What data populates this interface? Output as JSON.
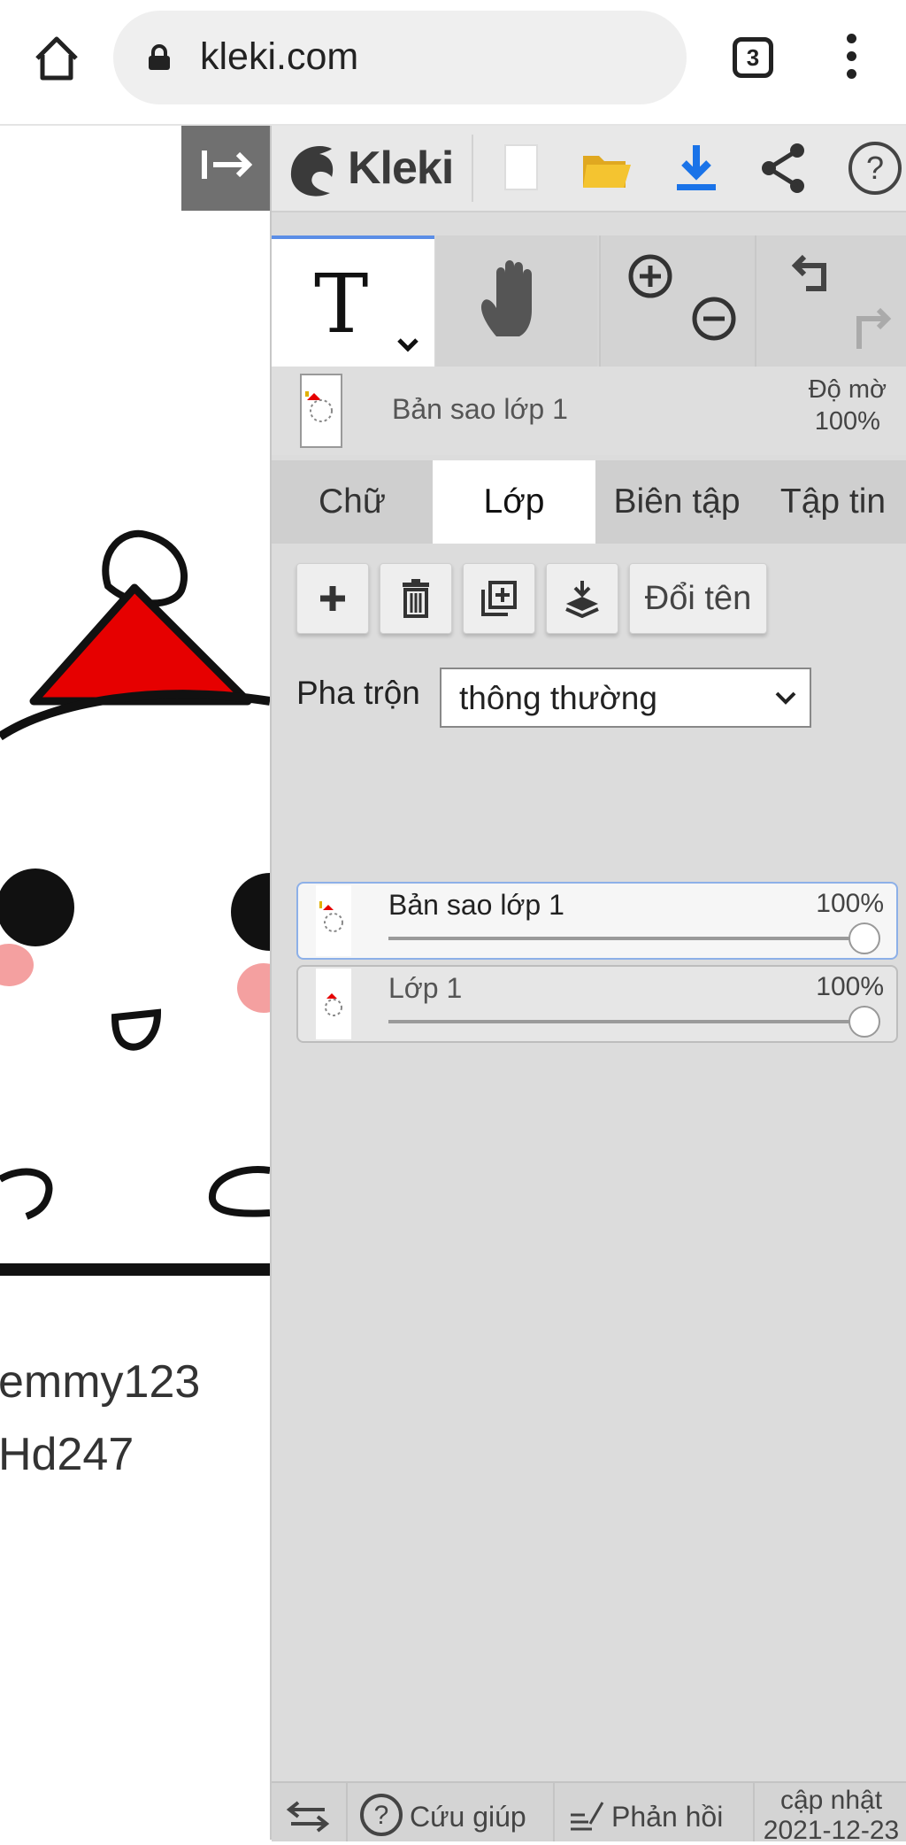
{
  "browser": {
    "url": "kleki.com",
    "tab_count": "3"
  },
  "canvas": {
    "text_lines": "emmy123\nHd247"
  },
  "toolbar": {
    "logo_text": "Kleki"
  },
  "layer_header": {
    "name": "Bản sao lớp 1",
    "opacity_label": "Độ mờ",
    "opacity_value": "100%"
  },
  "tabs": [
    {
      "label": "Chữ"
    },
    {
      "label": "Lớp"
    },
    {
      "label": "Biên tập"
    },
    {
      "label": "Tập tin"
    }
  ],
  "layer_actions": {
    "rename_label": "Đổi tên"
  },
  "blend": {
    "label": "Pha trộn",
    "value": "thông thường"
  },
  "layers": [
    {
      "name": "Bản sao lớp 1",
      "opacity": "100%",
      "opacity_value": 1.0
    },
    {
      "name": "Lớp 1",
      "opacity": "100%",
      "opacity_value": 1.0
    }
  ],
  "footer": {
    "help_label": "Cứu giúp",
    "feedback_label": "Phản hồi",
    "update_label": "cập nhật",
    "update_date": "2021-12-23"
  },
  "colors": {
    "accent_blue": "#1a73e8",
    "hat_red": "#e60000",
    "cheek_pink": "#f4a0a0",
    "folder_yellow": "#f4c430"
  }
}
